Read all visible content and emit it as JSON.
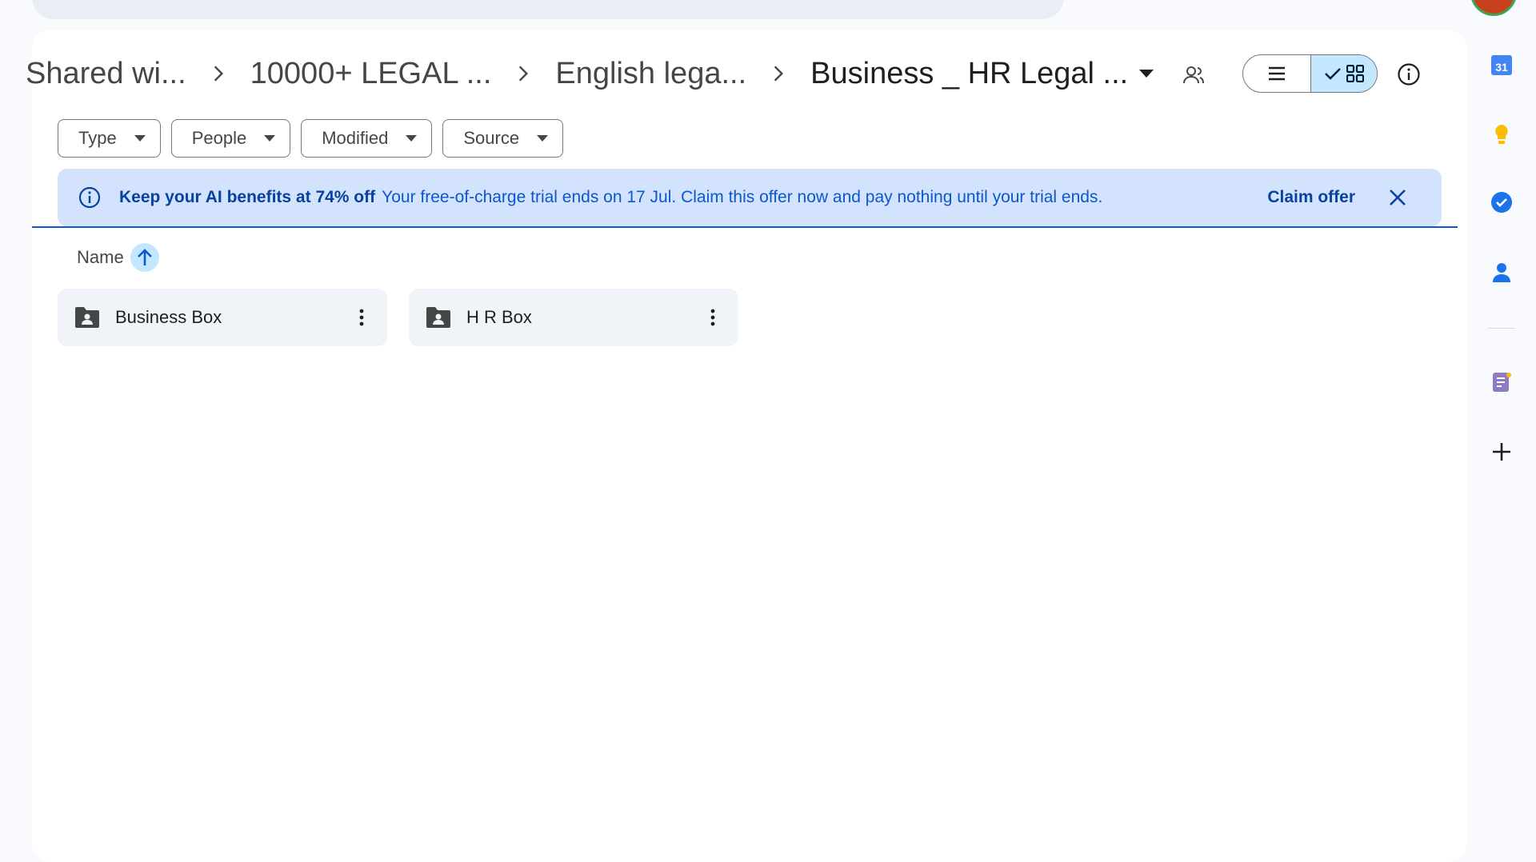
{
  "breadcrumb": {
    "items": [
      "Shared wi...",
      "10000+ LEGAL ...",
      "English lega...",
      "Business _ HR Legal ..."
    ]
  },
  "filters": [
    "Type",
    "People",
    "Modified",
    "Source"
  ],
  "banner": {
    "title": "Keep your AI benefits at 74% off",
    "message": "Your free-of-charge trial ends on 17 Jul. Claim this offer now and pay nothing until your trial ends.",
    "action": "Claim offer"
  },
  "list": {
    "sort_label": "Name"
  },
  "folders": [
    {
      "name": "Business Box"
    },
    {
      "name": "H R Box"
    }
  ],
  "side_rail": {
    "calendar_day": "31"
  },
  "colors": {
    "accent": "#0b57d0",
    "banner_bg": "#d3e3fd",
    "selected_toggle": "#c2e7ff",
    "card_bg": "#f0f4f9"
  }
}
